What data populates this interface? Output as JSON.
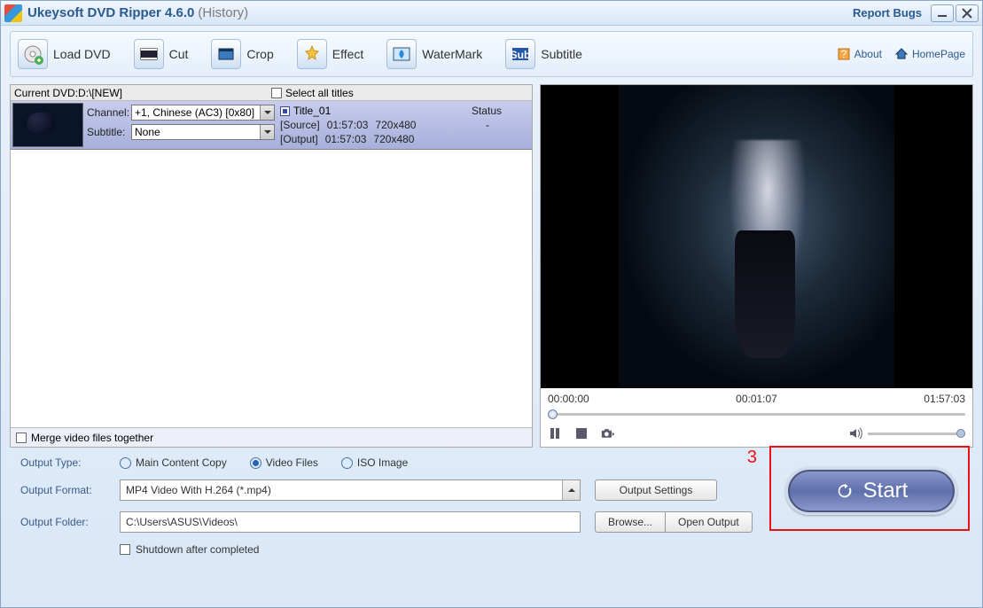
{
  "title": {
    "app": "Ukeysoft DVD Ripper 4.6.0",
    "suffix": "(History)",
    "report": "Report Bugs"
  },
  "toolbar": {
    "load": "Load DVD",
    "cut": "Cut",
    "crop": "Crop",
    "effect": "Effect",
    "watermark": "WaterMark",
    "subtitle": "Subtitle",
    "about": "About",
    "homepage": "HomePage"
  },
  "list": {
    "current": "Current DVD:D:\\[NEW]",
    "selectAll": "Select all titles",
    "channelLbl": "Channel:",
    "channelVal": "+1, Chinese (AC3) [0x80]",
    "subtitleLbl": "Subtitle:",
    "subtitleVal": "None",
    "titleName": "Title_01",
    "statusHdr": "Status",
    "sourceLbl": "[Source]",
    "outputLbl": "[Output]",
    "duration": "01:57:03",
    "res": "720x480",
    "dash": "-",
    "merge": "Merge video files together"
  },
  "player": {
    "t0": "00:00:00",
    "tcur": "00:01:07",
    "tend": "01:57:03"
  },
  "output": {
    "typeLbl": "Output Type:",
    "opt1": "Main Content Copy",
    "opt2": "Video Files",
    "opt3": "ISO Image",
    "formatLbl": "Output Format:",
    "formatVal": "MP4 Video With H.264 (*.mp4)",
    "folderLbl": "Output Folder:",
    "folderVal": "C:\\Users\\ASUS\\Videos\\",
    "settings": "Output Settings",
    "browse": "Browse...",
    "openOut": "Open Output",
    "shutdown": "Shutdown after completed",
    "start": "Start"
  },
  "annot": {
    "num": "3"
  }
}
